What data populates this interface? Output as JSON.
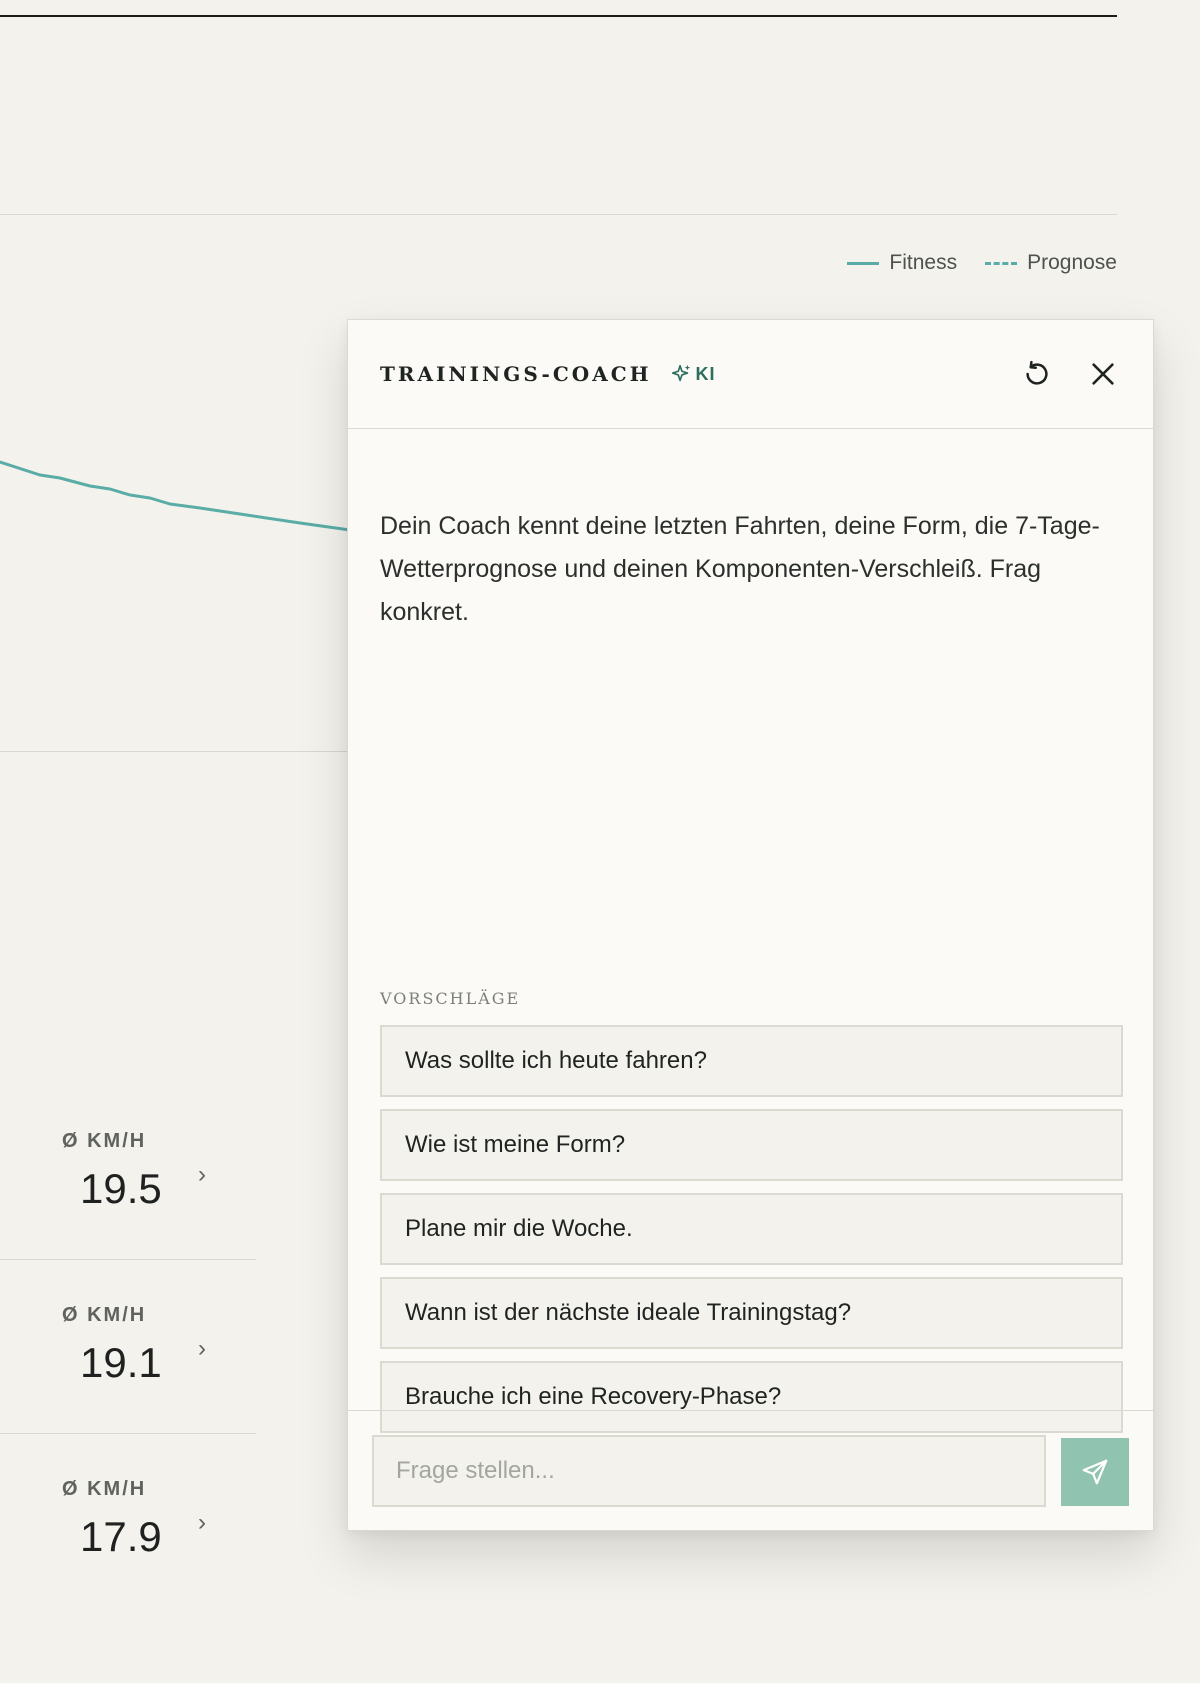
{
  "chart": {
    "legend": [
      {
        "label": "Fitness",
        "style": "solid"
      },
      {
        "label": "Prognose",
        "style": "dashed"
      }
    ],
    "line_color": "#5aaca6"
  },
  "stats": [
    {
      "label": "Ø KM/H",
      "value": "19.5"
    },
    {
      "label": "Ø KM/H",
      "value": "19.1"
    },
    {
      "label": "Ø KM/H",
      "value": "17.9"
    }
  ],
  "coach": {
    "title": "TRAININGS-COACH",
    "badge": "KI",
    "intro": "Dein Coach kennt deine letzten Fahrten, deine Form, die 7-Tage-Wetterprognose und deinen Komponenten-Verschleiß. Frag konkret.",
    "suggestions_label": "VORSCHLÄGE",
    "suggestions": [
      "Was sollte ich heute fahren?",
      "Wie ist meine Form?",
      "Plane mir die Woche.",
      "Wann ist der nächste ideale Trainingstag?",
      "Brauche ich eine Recovery-Phase?"
    ],
    "input_placeholder": "Frage stellen...",
    "input_value": "",
    "icons": {
      "badge": "sparkle-icon",
      "reset": "reset-icon",
      "close": "close-icon",
      "send": "send-icon"
    }
  },
  "colors": {
    "accent": "#2d6e5e",
    "send_button": "#91c4b0",
    "background": "#f4f2ec",
    "panel": "#fbfaf7"
  }
}
